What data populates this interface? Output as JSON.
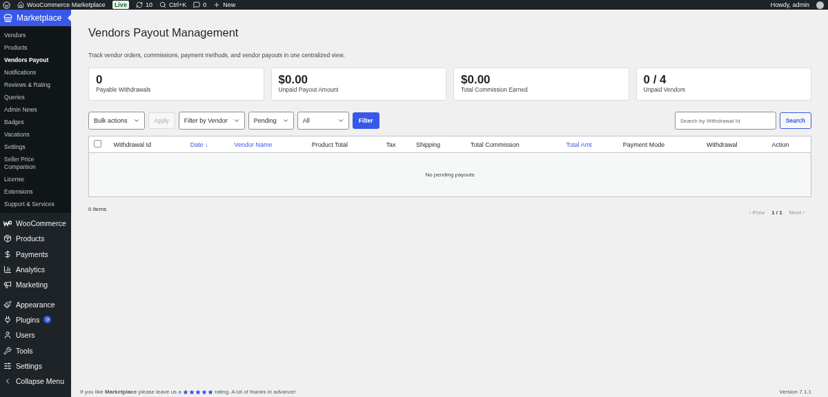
{
  "admin_bar": {
    "site_name": "WooCommerce Marketplace",
    "live_badge": "Live",
    "updates": "10",
    "search_shortcut": "Ctrl+K",
    "comments": "0",
    "new_label": "New",
    "greeting": "Howdy, admin"
  },
  "sidebar": {
    "parent": {
      "label": "Marketplace",
      "selected": true
    },
    "submenu": [
      {
        "label": "Vendors",
        "selected": false
      },
      {
        "label": "Products",
        "selected": false
      },
      {
        "label": "Vendors Payout",
        "selected": true
      },
      {
        "label": "Notifications",
        "selected": false
      },
      {
        "label": "Reviews & Rating",
        "selected": false
      },
      {
        "label": "Queries",
        "selected": false
      },
      {
        "label": "Admin News",
        "selected": false
      },
      {
        "label": "Badges",
        "selected": false
      },
      {
        "label": "Vacations",
        "selected": false
      },
      {
        "label": "Settings",
        "selected": false
      },
      {
        "label": "Seller Price Comparison",
        "selected": false
      },
      {
        "label": "License",
        "selected": false
      },
      {
        "label": "Extensions",
        "selected": false
      },
      {
        "label": "Support & Services",
        "selected": false
      }
    ],
    "menu_groups": [
      [
        {
          "label": "WooCommerce"
        },
        {
          "label": "Products"
        },
        {
          "label": "Payments"
        },
        {
          "label": "Analytics"
        },
        {
          "label": "Marketing"
        }
      ],
      [
        {
          "label": "Appearance"
        },
        {
          "label": "Plugins",
          "badge": "9"
        },
        {
          "label": "Users"
        },
        {
          "label": "Tools"
        },
        {
          "label": "Settings"
        },
        {
          "label": "Collapse Menu"
        }
      ]
    ]
  },
  "page": {
    "title": "Vendors Payout Management",
    "description": "Track vendor orders, commissions, payment methods, and vendor payouts in one centralized view.",
    "stats": [
      {
        "value": "0",
        "label": "Payable Withdrawals"
      },
      {
        "value": "$0.00",
        "label": "Unpaid Payout Amount"
      },
      {
        "value": "$0.00",
        "label": "Total Commission Earned"
      },
      {
        "value": "0 / 4",
        "label": "Unpaid Vendors"
      }
    ],
    "toolbar": {
      "bulk_actions": "Bulk actions",
      "apply": {
        "label": "Apply",
        "disabled": true
      },
      "vendor_filter": "Filter by Vendor",
      "status_filter": "Pending",
      "period_filter": "All",
      "filter_button": "Filter",
      "search": {
        "placeholder": "Search by Withdrawal Id"
      },
      "search_button": "Search"
    },
    "table": {
      "select_all_checked": false,
      "columns": [
        {
          "label": "Withdrawal Id",
          "sortable": false
        },
        {
          "label": "Date ↓",
          "sortable": true
        },
        {
          "label": "Vendor Name",
          "sortable": true
        },
        {
          "label": "Product Total",
          "sortable": false
        },
        {
          "label": "Tax",
          "sortable": false
        },
        {
          "label": "Shipping",
          "sortable": false
        },
        {
          "label": "Total Commission",
          "sortable": false
        },
        {
          "label": "Total Amt",
          "sortable": true
        },
        {
          "label": "Payment Mode",
          "sortable": false
        },
        {
          "label": "Withdrawal",
          "sortable": false
        },
        {
          "label": "Action",
          "sortable": false
        }
      ],
      "empty_message": "No pending payouts"
    },
    "item_count": "0 Items",
    "pagination": {
      "prev": "‹ Prev",
      "current": "1 / 1",
      "next": "Next ›"
    }
  },
  "footer": {
    "before": "If you like **Marketplace** please leave us a",
    "stars": 5,
    "after": "rating. A lot of thanks in advance!",
    "version": "Version 7.1.1"
  }
}
